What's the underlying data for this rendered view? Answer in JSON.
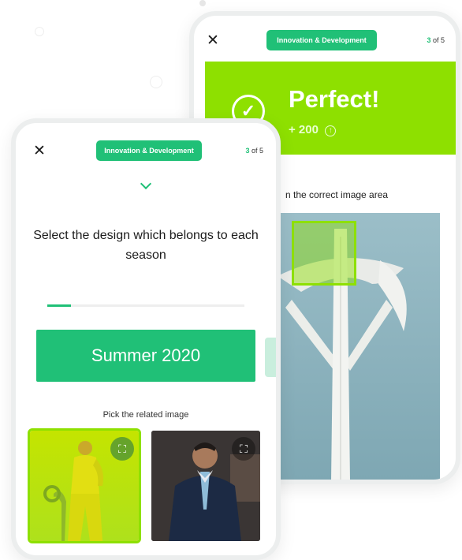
{
  "colors": {
    "accent_green": "#20c077",
    "lime_green": "#8ee000",
    "text_dark": "#1b1b1b"
  },
  "back_screen": {
    "close_icon": "close-icon",
    "category_label": "Innovation & Development",
    "step": {
      "current": "3",
      "of_total": "of 5"
    },
    "result": {
      "title": "Perfect!",
      "points": "+ 200",
      "check_icon": "check-circle-icon",
      "points_icon": "arrow-up-circle-icon"
    },
    "instruction_visible": "n the correct image area",
    "photo_icon": "tower-photo"
  },
  "front_screen": {
    "close_icon": "close-icon",
    "category_label": "Innovation & Development",
    "step": {
      "current": "3",
      "of_total": "of 5"
    },
    "chevron_icon": "chevron-down-icon",
    "question": "Select the design which belongs to each season",
    "progress_fraction": 0.12,
    "answer_label": "Summer 2020",
    "pick_label": "Pick the related image",
    "tiles": [
      {
        "name": "yellow-outfit-photo",
        "selected": true,
        "expand_icon": "expand-icon"
      },
      {
        "name": "suit-man-photo",
        "selected": false,
        "expand_icon": "expand-icon"
      }
    ]
  }
}
